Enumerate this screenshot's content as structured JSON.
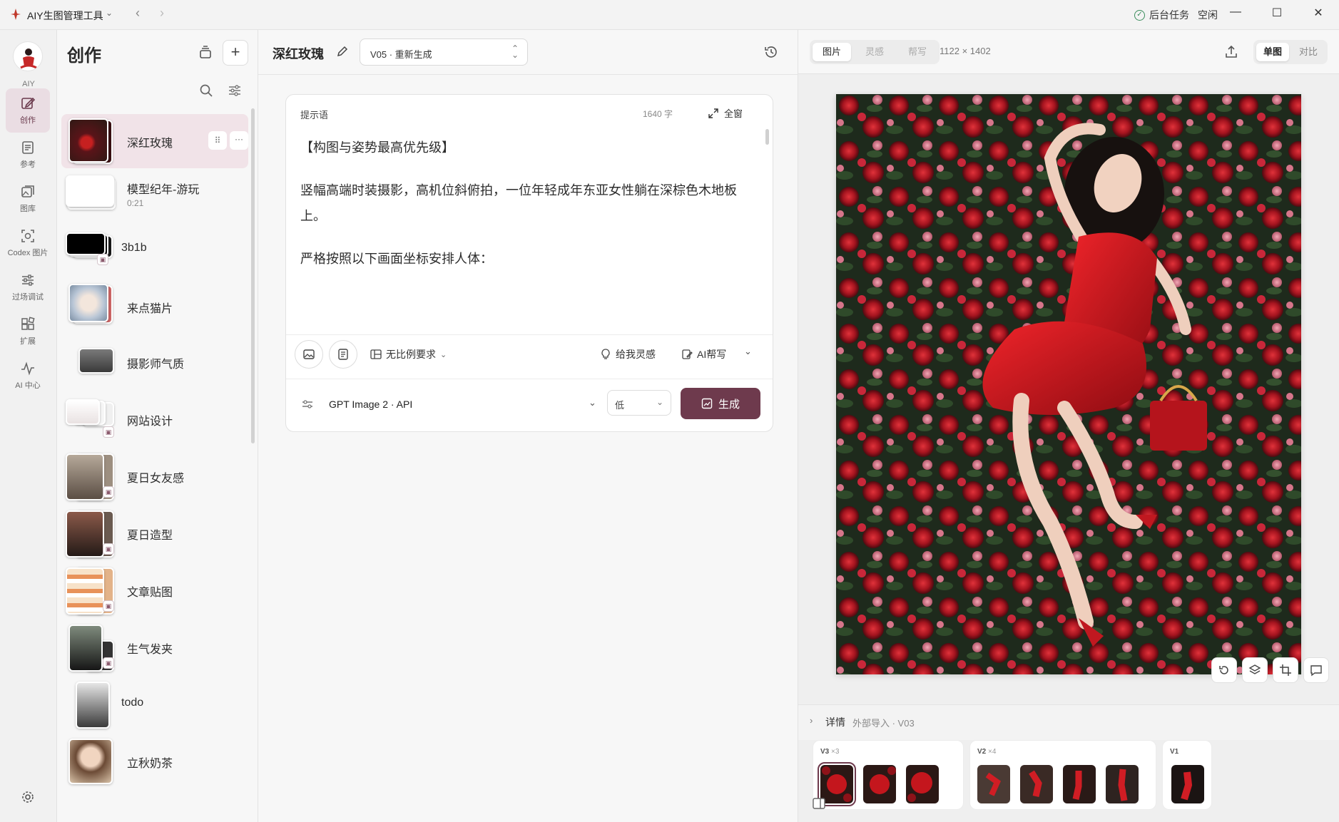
{
  "titlebar": {
    "app_name": "AIY生图管理工具",
    "task_label": "后台任务",
    "task_status": "空闲"
  },
  "rail": {
    "logo_label": "AIY",
    "items": [
      {
        "label": "创作",
        "icon": "edit-icon"
      },
      {
        "label": "参考",
        "icon": "document-icon"
      },
      {
        "label": "图库",
        "icon": "gallery-icon"
      },
      {
        "label": "Codex 图片",
        "icon": "scan-image-icon"
      },
      {
        "label": "过场调试",
        "icon": "sliders-icon"
      },
      {
        "label": "扩展",
        "icon": "extensions-icon"
      },
      {
        "label": "AI 中心",
        "icon": "pulse-icon"
      }
    ]
  },
  "list": {
    "title": "创作",
    "items": [
      {
        "name": "深红玫瑰",
        "sub": ""
      },
      {
        "name": "模型纪年-游玩",
        "sub": "0:21"
      },
      {
        "name": "3b1b",
        "sub": ""
      },
      {
        "name": "来点猫片",
        "sub": ""
      },
      {
        "name": "摄影师气质",
        "sub": ""
      },
      {
        "name": "网站设计",
        "sub": ""
      },
      {
        "name": "夏日女友感",
        "sub": ""
      },
      {
        "name": "夏日造型",
        "sub": ""
      },
      {
        "name": "文章贴图",
        "sub": ""
      },
      {
        "name": "生气发夹",
        "sub": ""
      },
      {
        "name": "todo",
        "sub": ""
      },
      {
        "name": "立秋奶茶",
        "sub": ""
      }
    ]
  },
  "editor": {
    "title": "深红玫瑰",
    "version": "V05 · 重新生成",
    "prompt_label": "提示语",
    "char_count": "1640 字",
    "fullscreen_label": "全窗",
    "prompt_paragraphs": [
      "【构图与姿势最高优先级】",
      "竖幅高端时装摄影，高机位斜俯拍，一位年轻成年东亚女性躺在深棕色木地板上。",
      "严格按照以下画面坐标安排人体："
    ],
    "ratio_label": "无比例要求",
    "inspire_label": "给我灵感",
    "ai_write_label": "AI帮写",
    "model": "GPT Image 2 · API",
    "quality": "低",
    "generate_label": "生成"
  },
  "viewer": {
    "tabs": [
      "图片",
      "灵感",
      "帮写"
    ],
    "dimensions": "1122 × 1402",
    "modes": [
      "单图",
      "对比"
    ],
    "details_label": "详情",
    "details_source": "外部导入 · V03",
    "version_groups": [
      {
        "label": "V3",
        "count": "×3",
        "thumbs": 3
      },
      {
        "label": "V2",
        "count": "×4",
        "thumbs": 4
      },
      {
        "label": "V1",
        "count": "",
        "thumbs": 1
      }
    ]
  },
  "colors": {
    "accent": "#6e3a4d",
    "active_bg": "#f1e3e8"
  }
}
